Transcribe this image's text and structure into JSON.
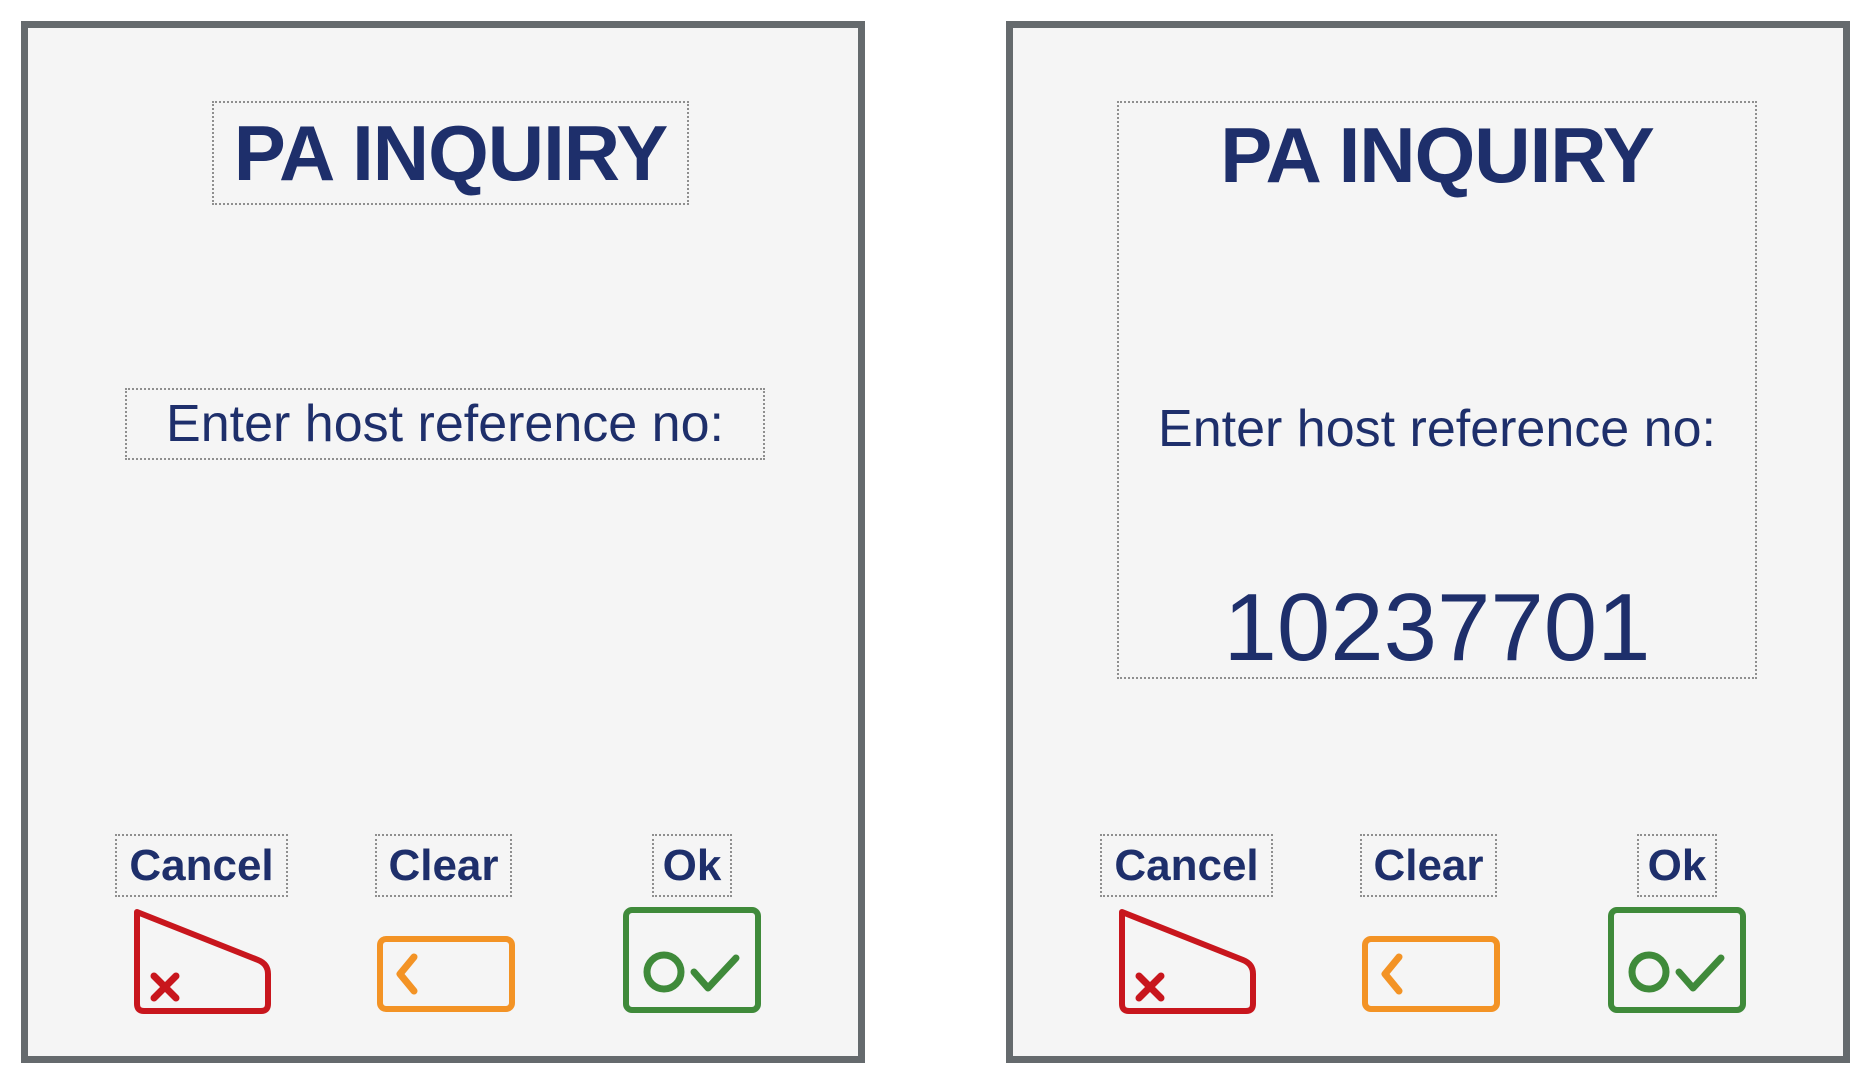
{
  "screens": [
    {
      "title": "PA INQUIRY",
      "prompt": "Enter host reference no:",
      "value": "",
      "buttons": {
        "cancel": "Cancel",
        "clear": "Clear",
        "ok": "Ok"
      }
    },
    {
      "title": "PA INQUIRY",
      "prompt": "Enter host reference no:",
      "value": "10237701",
      "buttons": {
        "cancel": "Cancel",
        "clear": "Clear",
        "ok": "Ok"
      }
    }
  ],
  "icons": {
    "cancel": "cancel-x-key-icon",
    "clear": "backspace-arrow-key-icon",
    "ok": "ok-circle-check-key-icon"
  },
  "colors": {
    "text": "#1e2f6b",
    "frame": "#656a6d",
    "background": "#f5f5f5",
    "cancel": "#c8161d",
    "clear": "#f39325",
    "ok": "#3f8a3a"
  }
}
